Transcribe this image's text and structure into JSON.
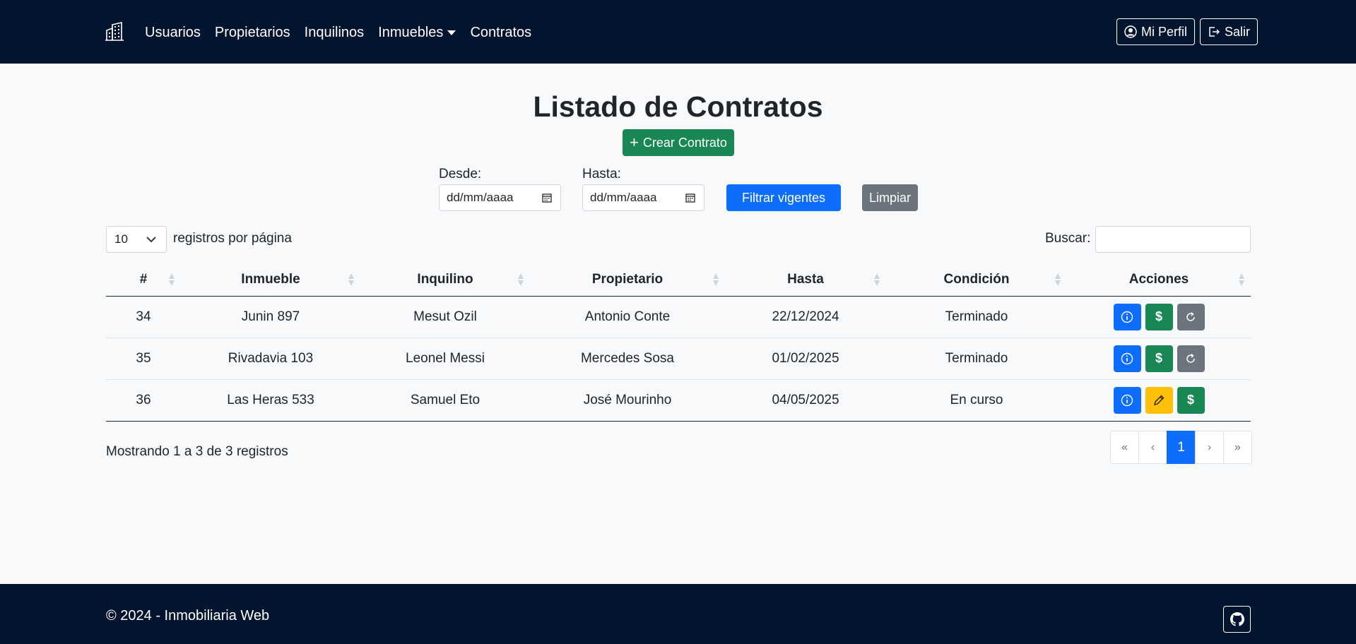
{
  "navbar": {
    "brand_icon": "building-icon",
    "links": [
      {
        "label": "Usuarios"
      },
      {
        "label": "Propietarios"
      },
      {
        "label": "Inquilinos"
      },
      {
        "label": "Inmuebles",
        "dropdown": true
      },
      {
        "label": "Contratos"
      }
    ],
    "profile_label": "Mi Perfil",
    "profile_icon": "user-circle-icon",
    "logout_label": "Salir",
    "logout_icon": "logout-icon",
    "background_color": "#03142f"
  },
  "page": {
    "title": "Listado de Contratos",
    "create_label": "Crear Contrato",
    "create_icon": "plus-icon"
  },
  "filters": {
    "from_label": "Desde:",
    "from_placeholder": "dd/mm/aaaa",
    "to_label": "Hasta:",
    "to_placeholder": "dd/mm/aaaa",
    "filter_label": "Filtrar vigentes",
    "clear_label": "Limpiar"
  },
  "table_controls": {
    "page_length": "10",
    "page_length_label": "registros por página",
    "search_label": "Buscar:",
    "search_value": ""
  },
  "table": {
    "columns": [
      "#",
      "Inmueble",
      "Inquilino",
      "Propietario",
      "Hasta",
      "Condición",
      "Acciones"
    ],
    "rows": [
      {
        "id": "34",
        "inmueble": "Junin 897",
        "inquilino": "Mesut Ozil",
        "propietario": "Antonio Conte",
        "hasta": "22/12/2024",
        "condicion": "Terminado",
        "actions": [
          "info",
          "pay",
          "renew"
        ]
      },
      {
        "id": "35",
        "inmueble": "Rivadavia 103",
        "inquilino": "Leonel Messi",
        "propietario": "Mercedes Sosa",
        "hasta": "01/02/2025",
        "condicion": "Terminado",
        "actions": [
          "info",
          "pay",
          "renew"
        ]
      },
      {
        "id": "36",
        "inmueble": "Las Heras 533",
        "inquilino": "Samuel Eto",
        "propietario": "José Mourinho",
        "hasta": "04/05/2025",
        "condicion": "En curso",
        "actions": [
          "info",
          "edit",
          "pay"
        ]
      }
    ]
  },
  "footer_info": {
    "showing": "Mostrando 1 a 3 de 3 registros",
    "pagination": {
      "first": "«",
      "prev": "‹",
      "current": "1",
      "next": "›",
      "last": "»"
    }
  },
  "footer": {
    "text": "© 2024 - Inmobiliaria Web",
    "github_icon": "github-icon"
  },
  "colors": {
    "primary": "#0d6efd",
    "success": "#198754",
    "secondary": "#6c757d",
    "warning": "#ffc107"
  }
}
